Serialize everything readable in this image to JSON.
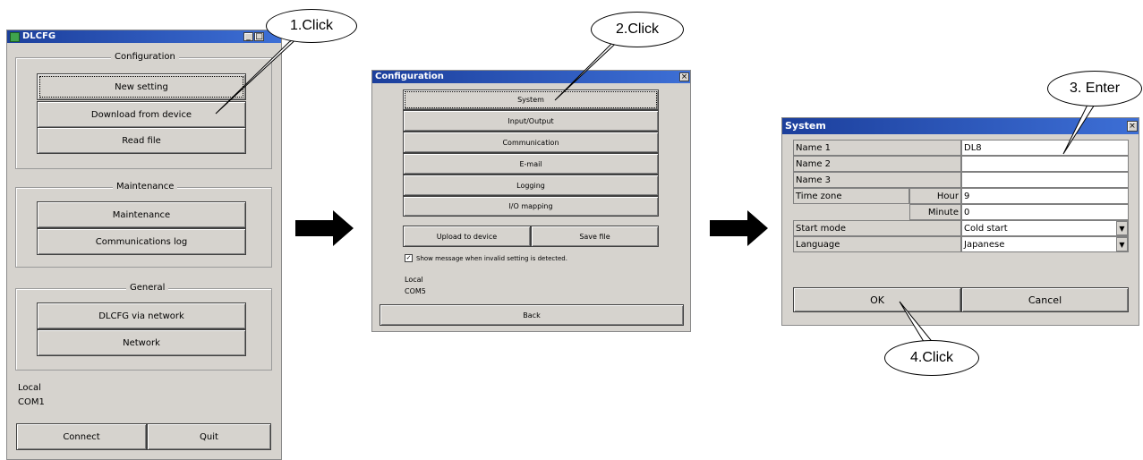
{
  "win1": {
    "title": "DLCFG",
    "configuration_legend": "Configuration",
    "new_setting": "New setting",
    "download": "Download from device",
    "read_file": "Read file",
    "maintenance_legend": "Maintenance",
    "maintenance": "Maintenance",
    "comm_log": "Communications log",
    "general_legend": "General",
    "dlcfg_network": "DLCFG via network",
    "network": "Network",
    "local": "Local",
    "port": "COM1",
    "connect": "Connect",
    "quit": "Quit"
  },
  "win2": {
    "title": "Configuration",
    "close": "×",
    "system": "System",
    "io": "Input/Output",
    "communication": "Communication",
    "email": "E-mail",
    "logging": "Logging",
    "io_mapping": "I/O mapping",
    "upload": "Upload to device",
    "save_file": "Save file",
    "checkbox_label": "Show message when invalid setting is detected.",
    "checkbox_checked": true,
    "local": "Local",
    "port": "COM5",
    "back": "Back"
  },
  "win3": {
    "title": "System",
    "close": "×",
    "name1_label": "Name 1",
    "name1_value": "DL8",
    "name2_label": "Name 2",
    "name2_value": "",
    "name3_label": "Name 3",
    "name3_value": "",
    "timezone_label": "Time zone",
    "hour_label": "Hour",
    "hour_value": "9",
    "minute_label": "Minute",
    "minute_value": "0",
    "startmode_label": "Start mode",
    "startmode_value": "Cold start",
    "language_label": "Language",
    "language_value": "Japanese",
    "ok": "OK",
    "cancel": "Cancel"
  },
  "callouts": {
    "c1": "1.Click",
    "c2": "2.Click",
    "c3": "3. Enter",
    "c4": "4.Click"
  }
}
